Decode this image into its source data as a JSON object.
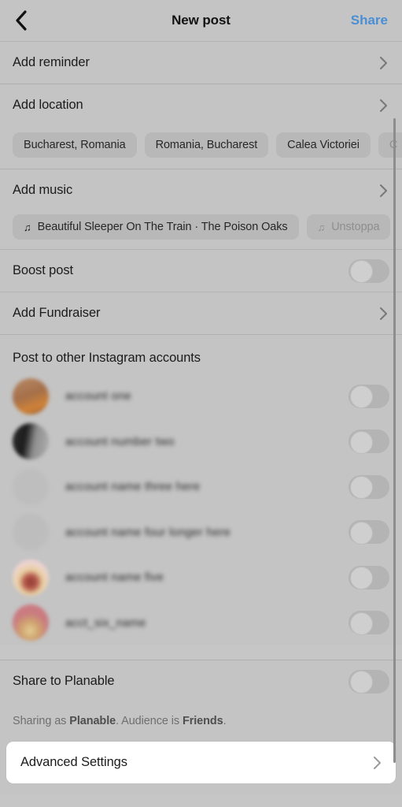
{
  "header": {
    "back_icon": "chevron-left-icon",
    "title": "New post",
    "share_label": "Share"
  },
  "rows": {
    "reminder_label": "Add reminder",
    "location_label": "Add location",
    "music_label": "Add music",
    "boost_label": "Boost post",
    "fundraiser_label": "Add Fundraiser",
    "planable_label": "Share to Planable",
    "advanced_label": "Advanced Settings"
  },
  "location_chips": [
    {
      "label": "Bucharest, Romania"
    },
    {
      "label": "Romania, Bucharest"
    },
    {
      "label": "Calea Victoriei"
    },
    {
      "label": "C"
    }
  ],
  "music_chips": [
    {
      "icon": "music-note-icon",
      "label": "Beautiful Sleeper On The Train · The Poison Oaks",
      "faded": false
    },
    {
      "icon": "music-note-icon",
      "label": "Unstoppa",
      "faded": true
    }
  ],
  "accounts_section": {
    "title": "Post to other Instagram accounts",
    "accounts": [
      {
        "name": "account one",
        "avatar_color": "#a97a58",
        "avatar_color2": "#c9793a"
      },
      {
        "name": "account number two",
        "avatar_color": "#4a4a4a",
        "avatar_color2": "#9b9b9b"
      },
      {
        "name": "account name three here",
        "avatar_color": "#bdbdbd",
        "avatar_color2": "#bdbdbd"
      },
      {
        "name": "account name four longer here",
        "avatar_color": "#bcbcbc",
        "avatar_color2": "#bcbcbc"
      },
      {
        "name": "account name five",
        "avatar_color": "#e9c9c9",
        "avatar_color2": "#b05a4a"
      },
      {
        "name": "acct_six_name",
        "avatar_color": "#cf7b80",
        "avatar_color2": "#e0c48a"
      }
    ]
  },
  "footnote": {
    "prefix": "Sharing as ",
    "profile": "Planable",
    "middle": ". Audience is ",
    "audience": "Friends",
    "suffix": "."
  },
  "toggles": {
    "state": "off"
  },
  "colors": {
    "share_blue": "#4a8fd4",
    "background": "#c4c4c4",
    "chip": "#b8b8b8",
    "highlight": "#ffffff"
  }
}
